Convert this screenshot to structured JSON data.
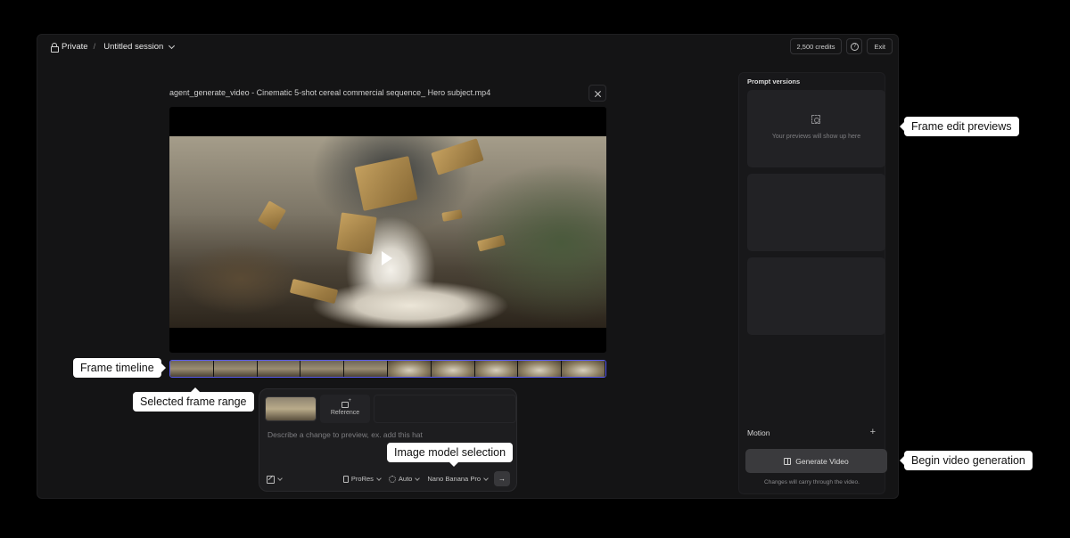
{
  "header": {
    "privacy": "Private",
    "separator": "/",
    "session": "Untitled session",
    "credits": "2,500 credits",
    "help": "?",
    "exit": "Exit"
  },
  "video": {
    "title": "agent_generate_video - Cinematic 5-shot cereal commercial sequence_ Hero subject.mp4"
  },
  "composer": {
    "reference_label": "Reference",
    "placeholder": "Describe a change to preview, ex. add this hat",
    "format": "ProRes",
    "mode": "Auto",
    "model": "Nano Banana Pro",
    "send": "→"
  },
  "panel": {
    "title": "Prompt versions",
    "empty_text": "Your previews will show up here",
    "motion_label": "Motion",
    "motion_add": "+",
    "generate_label": "Generate Video",
    "note": "Changes will carry through the video."
  },
  "callouts": {
    "frame_edit_previews": "Frame edit previews",
    "frame_timeline": "Frame timeline",
    "selected_frame_range": "Selected frame range",
    "image_model_selection": "Image model selection",
    "begin_video_generation": "Begin video generation"
  },
  "icons": {
    "lock": "lock-icon",
    "chevron": "chevron-down-icon",
    "close": "close-icon",
    "play": "play-icon",
    "image_add": "image-add-icon",
    "edit": "edit-icon",
    "document": "document-icon",
    "auto": "auto-icon",
    "scan": "scan-icon",
    "film": "film-icon"
  },
  "colors": {
    "accent_timeline": "#5a5cf0",
    "background": "#141415"
  }
}
